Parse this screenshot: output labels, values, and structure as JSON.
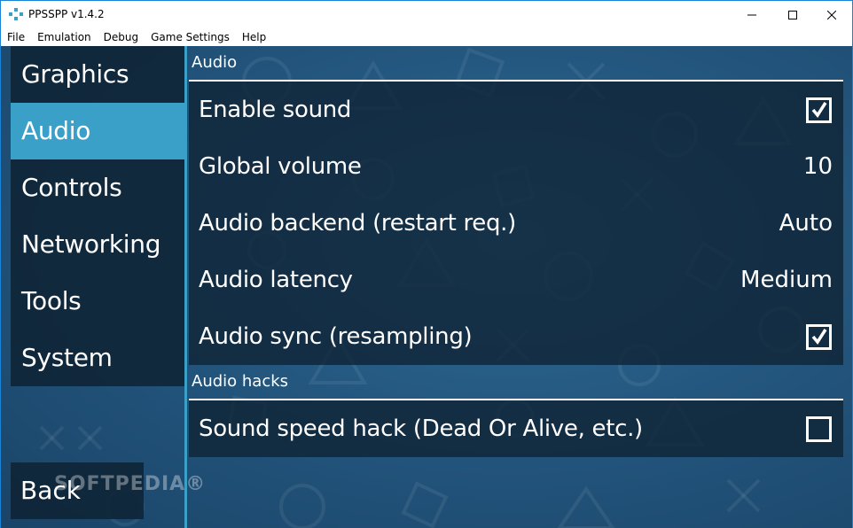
{
  "window": {
    "title": "PPSSPP v1.4.2",
    "controls": {
      "minimize": "minimize-icon",
      "maximize": "maximize-icon",
      "close": "close-icon"
    }
  },
  "menu": {
    "items": [
      "File",
      "Emulation",
      "Debug",
      "Game Settings",
      "Help"
    ]
  },
  "sidebar": {
    "items": [
      {
        "label": "Graphics",
        "active": false
      },
      {
        "label": "Audio",
        "active": true
      },
      {
        "label": "Controls",
        "active": false
      },
      {
        "label": "Networking",
        "active": false
      },
      {
        "label": "Tools",
        "active": false
      },
      {
        "label": "System",
        "active": false
      }
    ],
    "back_label": "Back"
  },
  "watermark": "SOFTPEDIA®",
  "sections": [
    {
      "title": "Audio",
      "settings": [
        {
          "label": "Enable sound",
          "type": "checkbox",
          "checked": true
        },
        {
          "label": "Global volume",
          "type": "value",
          "value": "10"
        },
        {
          "label": "Audio backend (restart req.)",
          "type": "value",
          "value": "Auto"
        },
        {
          "label": "Audio latency",
          "type": "value",
          "value": "Medium"
        },
        {
          "label": "Audio sync (resampling)",
          "type": "checkbox",
          "checked": true
        }
      ]
    },
    {
      "title": "Audio hacks",
      "settings": [
        {
          "label": "Sound speed hack (Dead Or Alive, etc.)",
          "type": "checkbox",
          "checked": false
        }
      ]
    }
  ],
  "colors": {
    "accent": "#3ba0c8",
    "panel": "#0f2334",
    "background": "#24577f"
  }
}
